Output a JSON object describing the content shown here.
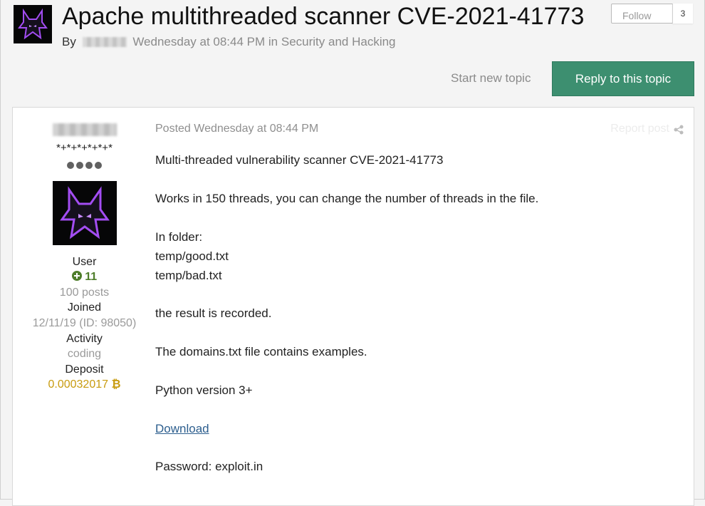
{
  "topic": {
    "title": "Apache multithreaded scanner CVE-2021-41773",
    "by_label": "By",
    "date": "Wednesday at 08:44 PM",
    "in_label": "in",
    "forum": "Security and Hacking"
  },
  "follow": {
    "label": "Follow",
    "count": "3"
  },
  "actions": {
    "start_new_topic": "Start new topic",
    "reply": "Reply to this topic"
  },
  "author": {
    "stars": "*+*+*+*+*+*",
    "group": "User",
    "reputation": "11",
    "posts": "100 posts",
    "joined_label": "Joined",
    "joined_value": "12/11/19 (ID: 98050)",
    "activity_label": "Activity",
    "activity_value": "coding",
    "deposit_label": "Deposit",
    "deposit_value": "0.00032017",
    "deposit_icon": "bitcoin-icon"
  },
  "post": {
    "posted_prefix": "Posted",
    "posted_date": "Wednesday at 08:44 PM",
    "report": "Report post",
    "lines": [
      "Multi-threaded vulnerability scanner CVE-2021-41773",
      "Works in 150 threads, you can change the number of threads in the file.",
      "In folder:",
      "temp/good.txt",
      "temp/bad.txt",
      "the result is recorded.",
      "The domains.txt file contains examples.",
      "Python version 3+",
      "Download",
      "Password: exploit.in"
    ]
  },
  "colors": {
    "accent": "#3d8f70",
    "reputation": "#4e7d2a",
    "deposit": "#c89b0e",
    "link": "#2c5e8e"
  }
}
